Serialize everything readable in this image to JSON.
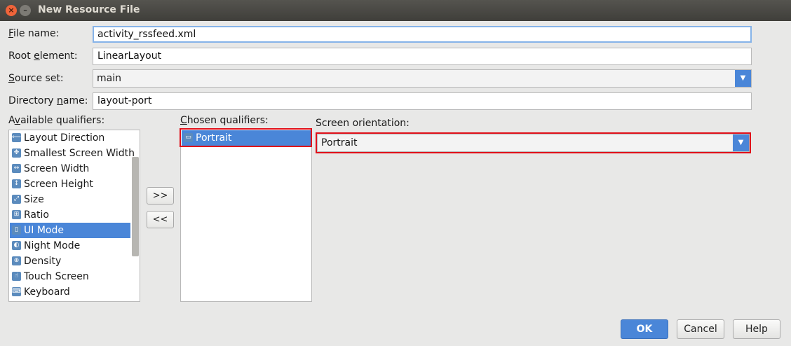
{
  "window": {
    "title": "New Resource File",
    "close_glyph": "×",
    "minimize_glyph": "–"
  },
  "fields": {
    "file_name": {
      "mnemonic": "F",
      "label_rest": "ile name:",
      "value": "activity_rssfeed.xml"
    },
    "root_element": {
      "label_pre": "Root ",
      "mnemonic": "e",
      "label_rest": "lement:",
      "value": "LinearLayout"
    },
    "source_set": {
      "mnemonic": "S",
      "label_rest": "ource set:",
      "value": "main"
    },
    "directory_name": {
      "label_pre": "Directory ",
      "mnemonic": "n",
      "label_rest": "ame:",
      "value": "layout-port"
    }
  },
  "available_qualifiers": {
    "label_pre": "A",
    "mnemonic": "v",
    "label_rest": "ailable qualifiers:",
    "items": [
      {
        "label": "Layout Direction",
        "icon": "layout-direction-icon",
        "glyph": "⟵"
      },
      {
        "label": "Smallest Screen Width",
        "icon": "smallest-width-icon",
        "glyph": "✥"
      },
      {
        "label": "Screen Width",
        "icon": "screen-width-icon",
        "glyph": "↔"
      },
      {
        "label": "Screen Height",
        "icon": "screen-height-icon",
        "glyph": "↕"
      },
      {
        "label": "Size",
        "icon": "size-icon",
        "glyph": "⤢"
      },
      {
        "label": "Ratio",
        "icon": "ratio-icon",
        "glyph": "⊞"
      },
      {
        "label": "UI Mode",
        "icon": "ui-mode-icon",
        "glyph": "▯"
      },
      {
        "label": "Night Mode",
        "icon": "night-mode-icon",
        "glyph": "◐"
      },
      {
        "label": "Density",
        "icon": "density-icon",
        "glyph": "⊕"
      },
      {
        "label": "Touch Screen",
        "icon": "touch-screen-icon",
        "glyph": "☝"
      },
      {
        "label": "Keyboard",
        "icon": "keyboard-icon",
        "glyph": "⌨"
      }
    ],
    "selected_index": 6
  },
  "chosen_qualifiers": {
    "label_pre": "",
    "mnemonic": "C",
    "label_rest": "hosen qualifiers:",
    "items": [
      {
        "label": "Portrait",
        "icon": "portrait-icon",
        "glyph": "▭"
      }
    ]
  },
  "move_buttons": {
    "add": ">>",
    "remove": "<<"
  },
  "screen_orientation": {
    "label": "Screen orientation:",
    "value": "Portrait",
    "arrow_glyph": "▼"
  },
  "buttons": {
    "ok": "OK",
    "cancel": "Cancel",
    "help": "Help"
  },
  "colors": {
    "accent": "#4a86d8",
    "highlight": "#e0101a",
    "background": "#e8e8e7"
  }
}
